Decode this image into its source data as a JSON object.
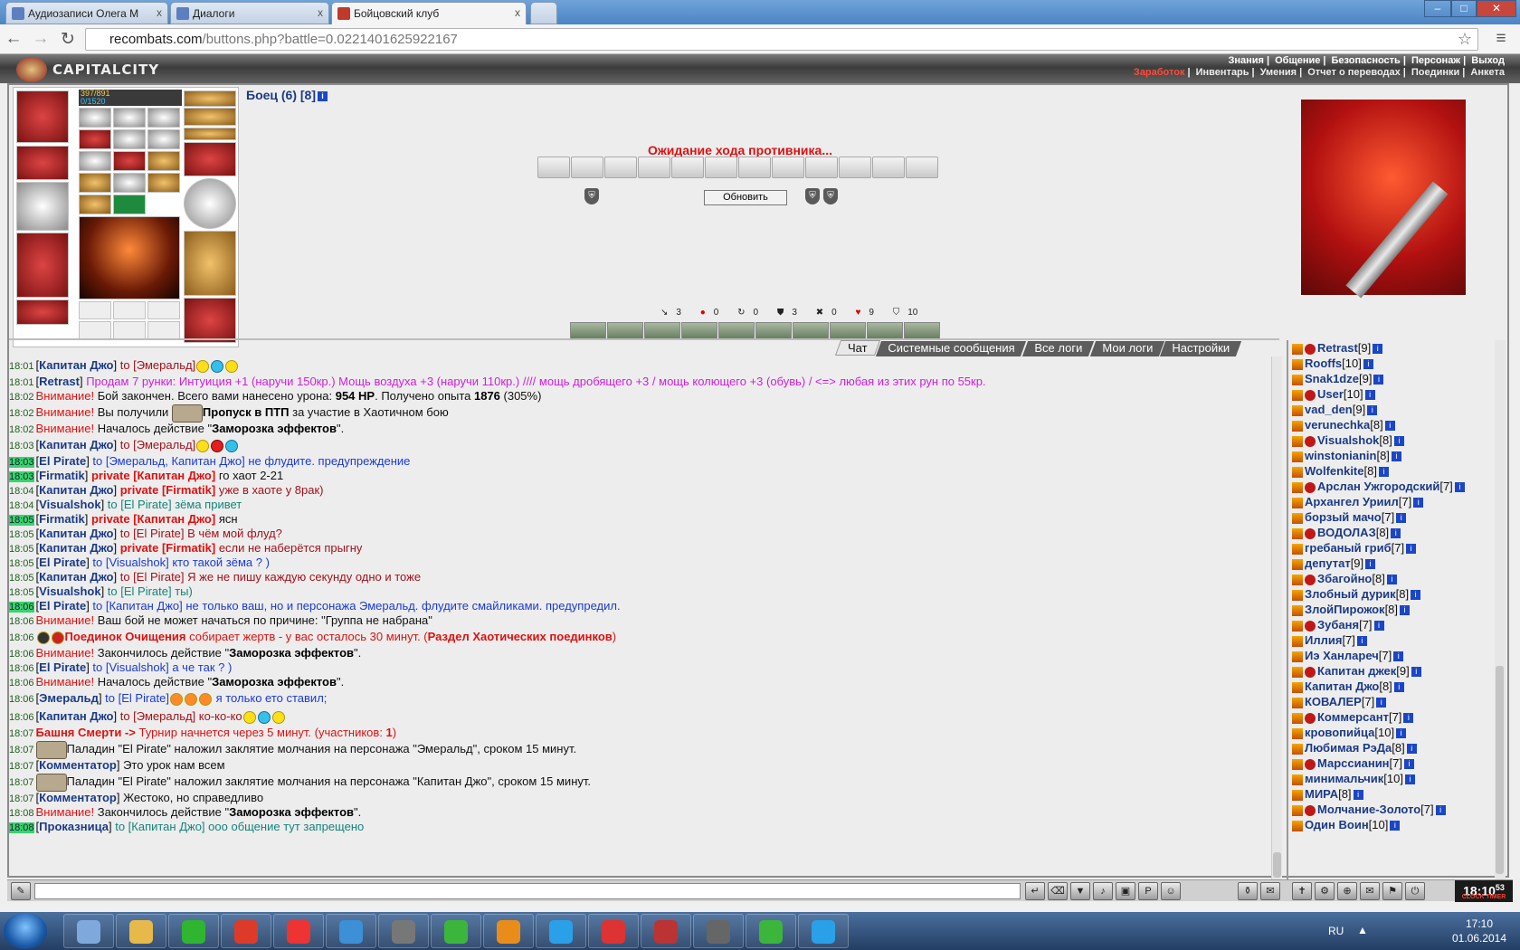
{
  "browser": {
    "tabs": [
      {
        "title": "Аудиозаписи Олега М",
        "icon_color": "#5b7fbf"
      },
      {
        "title": "Диалоги",
        "icon_color": "#5b7fbf"
      },
      {
        "title": "Бойцовский клуб",
        "icon_color": "#c0392b"
      }
    ],
    "close_glyph": "x",
    "window_controls": [
      "–",
      "□",
      "✕"
    ],
    "url_domain": "recombats.com",
    "url_path": "/buttons.php?battle=0.0221401625922167",
    "nav": {
      "back": "←",
      "forward": "→",
      "reload": "↻",
      "star": "☆",
      "menu": "≡"
    }
  },
  "site": {
    "logo": "CAPITALCITY",
    "menu_top": [
      "Знания",
      "Общение",
      "Безопасность",
      "Персонаж",
      "Выход"
    ],
    "menu_bottom": [
      "Заработок",
      "Инвентарь",
      "Умения",
      "Отчет о переводах",
      "Поединки",
      "Анкета"
    ]
  },
  "hero": {
    "hp": "397/891",
    "mp": "0/1520",
    "name": "Боец (6) [8]"
  },
  "battle": {
    "status": "Ожидание хода противника...",
    "refresh": "Обновить",
    "stats": [
      "3",
      "0",
      "0",
      "3",
      "0",
      "9",
      "10"
    ],
    "stat_icons": [
      "↘",
      "●",
      "↻",
      "⛊",
      "✖",
      "♥",
      "⛉"
    ]
  },
  "chat_tabs": [
    "Чат",
    "Системные сообщения",
    "Все логи",
    "Мои логи",
    "Настройки"
  ],
  "chat_lines": [
    {
      "t": "18:01",
      "hl": false,
      "parts": [
        [
          "br",
          "["
        ],
        [
          "nick",
          "Капитан Джо"
        ],
        [
          "br",
          "] "
        ],
        [
          "dred",
          "to [Эмеральд]"
        ]
      ],
      "smiles": [
        "y",
        "b",
        "y"
      ]
    },
    {
      "t": "18:01",
      "hl": false,
      "parts": [
        [
          "br",
          "["
        ],
        [
          "nick",
          "Retrast"
        ],
        [
          "br",
          "] "
        ],
        [
          "mag",
          "Продам 7 рунки: Интуиция +1 (наручи 150кр.) Мощь воздуха +3 (наручи 110кр.) //// мощь дробящего +3 / мощь колющего +3 (обувь) / <=> любая из этих рун по 55кр."
        ]
      ]
    },
    {
      "t": "18:02",
      "hl": false,
      "parts": [
        [
          "red",
          "Внимание! "
        ],
        [
          "br",
          "Бой закончен. Всего вами нанесено урона: "
        ],
        [
          "b",
          "954 HP"
        ],
        [
          "br",
          ". Получено опыта "
        ],
        [
          "b",
          "1876"
        ],
        [
          "br",
          " (305%)"
        ]
      ]
    },
    {
      "t": "18:02",
      "hl": false,
      "ticket": true,
      "parts": [
        [
          "red",
          "Внимание! "
        ],
        [
          "br",
          "Вы получили "
        ],
        [
          "b",
          "Пропуск в ПТП"
        ],
        [
          "br",
          " за участие в Хаотичном бою"
        ]
      ]
    },
    {
      "t": "18:02",
      "hl": false,
      "parts": [
        [
          "red",
          "Внимание! "
        ],
        [
          "br",
          "Началось действие \""
        ],
        [
          "b",
          "Заморозка эффектов"
        ],
        [
          "br",
          "\"."
        ]
      ]
    },
    {
      "t": "18:03",
      "hl": false,
      "parts": [
        [
          "br",
          "["
        ],
        [
          "nick",
          "Капитан Джо"
        ],
        [
          "br",
          "] "
        ],
        [
          "dred",
          "to [Эмеральд]"
        ]
      ],
      "smiles": [
        "y",
        "r",
        "b"
      ]
    },
    {
      "t": "18:03",
      "hl": true,
      "parts": [
        [
          "br",
          "["
        ],
        [
          "nick",
          "El Pirate"
        ],
        [
          "br",
          "] "
        ],
        [
          "blue",
          "to [Эмеральд, Капитан Джо] не флудите. предупреждение"
        ]
      ]
    },
    {
      "t": "18:03",
      "hl": true,
      "parts": [
        [
          "br",
          "["
        ],
        [
          "nick",
          "Firmatik"
        ],
        [
          "br",
          "] "
        ],
        [
          "redb",
          "private [Капитан Джо]"
        ],
        [
          "br",
          " го хаот 2-21"
        ]
      ]
    },
    {
      "t": "18:04",
      "hl": false,
      "parts": [
        [
          "br",
          "["
        ],
        [
          "nick",
          "Капитан Джо"
        ],
        [
          "br",
          "] "
        ],
        [
          "redb",
          "private [Firmatik]"
        ],
        [
          "dred",
          " уже в хаоте у 8рак)"
        ]
      ]
    },
    {
      "t": "18:04",
      "hl": false,
      "parts": [
        [
          "br",
          "["
        ],
        [
          "nick",
          "Visualshok"
        ],
        [
          "br",
          "] "
        ],
        [
          "teal",
          "to [El Pirate] зёма привет"
        ]
      ]
    },
    {
      "t": "18:05",
      "hl": true,
      "parts": [
        [
          "br",
          "["
        ],
        [
          "nick",
          "Firmatik"
        ],
        [
          "br",
          "] "
        ],
        [
          "redb",
          "private [Капитан Джо]"
        ],
        [
          "br",
          " ясн"
        ]
      ]
    },
    {
      "t": "18:05",
      "hl": false,
      "parts": [
        [
          "br",
          "["
        ],
        [
          "nick",
          "Капитан Джо"
        ],
        [
          "br",
          "] "
        ],
        [
          "dred",
          "to [El Pirate] В чём мой флуд?"
        ]
      ]
    },
    {
      "t": "18:05",
      "hl": false,
      "parts": [
        [
          "br",
          "["
        ],
        [
          "nick",
          "Капитан Джо"
        ],
        [
          "br",
          "] "
        ],
        [
          "redb",
          "private [Firmatik]"
        ],
        [
          "dred",
          " если не наберётся прыгну"
        ]
      ]
    },
    {
      "t": "18:05",
      "hl": false,
      "parts": [
        [
          "br",
          "["
        ],
        [
          "nick",
          "El Pirate"
        ],
        [
          "br",
          "] "
        ],
        [
          "blue",
          "to [Visualshok] кто такой зёма ? )"
        ]
      ]
    },
    {
      "t": "18:05",
      "hl": false,
      "parts": [
        [
          "br",
          "["
        ],
        [
          "nick",
          "Капитан Джо"
        ],
        [
          "br",
          "] "
        ],
        [
          "dred",
          "to [El Pirate] Я же не пишу каждую секунду одно и тоже"
        ]
      ]
    },
    {
      "t": "18:05",
      "hl": false,
      "parts": [
        [
          "br",
          "["
        ],
        [
          "nick",
          "Visualshok"
        ],
        [
          "br",
          "] "
        ],
        [
          "teal",
          "to [El Pirate] ты)"
        ]
      ]
    },
    {
      "t": "18:06",
      "hl": true,
      "parts": [
        [
          "br",
          "["
        ],
        [
          "nick",
          "El Pirate"
        ],
        [
          "br",
          "] "
        ],
        [
          "blue",
          "to [Капитан Джо] не только ваш, но и персонажа Эмеральд. флудите смайликами. предупредил."
        ]
      ]
    },
    {
      "t": "18:06",
      "hl": false,
      "parts": [
        [
          "red",
          "Внимание! "
        ],
        [
          "br",
          "Ваш бой не может начаться по причине: \"Группа не набрана\""
        ]
      ]
    },
    {
      "t": "18:06",
      "hl": false,
      "icons": true,
      "parts": [
        [
          "redb",
          "Поединок Очищения"
        ],
        [
          "red",
          " собирает жертв - у вас осталось 30 минут. ("
        ],
        [
          "redb",
          "Раздел Хаотических поединков"
        ],
        [
          "red",
          ")"
        ]
      ]
    },
    {
      "t": "18:06",
      "hl": false,
      "parts": [
        [
          "red",
          "Внимание! "
        ],
        [
          "br",
          "Закончилось действие \""
        ],
        [
          "b",
          "Заморозка эффектов"
        ],
        [
          "br",
          "\"."
        ]
      ]
    },
    {
      "t": "18:06",
      "hl": false,
      "parts": [
        [
          "br",
          "["
        ],
        [
          "nick",
          "El Pirate"
        ],
        [
          "br",
          "] "
        ],
        [
          "blue",
          "to [Visualshok] а че так ? )"
        ]
      ]
    },
    {
      "t": "18:06",
      "hl": false,
      "parts": [
        [
          "red",
          "Внимание! "
        ],
        [
          "br",
          "Началось действие \""
        ],
        [
          "b",
          "Заморозка эффектов"
        ],
        [
          "br",
          "\"."
        ]
      ]
    },
    {
      "t": "18:06",
      "hl": false,
      "smilesMid": true,
      "parts": [
        [
          "br",
          "["
        ],
        [
          "nick",
          "Эмеральд"
        ],
        [
          "br",
          "] "
        ],
        [
          "blue",
          "to [El Pirate]"
        ]
      ],
      "tail": [
        [
          "blue",
          " я только ето ставил;"
        ]
      ]
    },
    {
      "t": "18:06",
      "hl": false,
      "parts": [
        [
          "br",
          "["
        ],
        [
          "nick",
          "Капитан Джо"
        ],
        [
          "br",
          "] "
        ],
        [
          "dred",
          "to [Эмеральд] ко-ко-ко"
        ]
      ],
      "smiles": [
        "y",
        "b",
        "y"
      ]
    },
    {
      "t": "18:07",
      "hl": false,
      "parts": [
        [
          "redb",
          "Башня Смерти -> "
        ],
        [
          "red",
          "Турнир начнется через 5 минут. (участников: "
        ],
        [
          "redb",
          "1"
        ],
        [
          "red",
          ")"
        ]
      ]
    },
    {
      "t": "18:07",
      "hl": false,
      "ticket": true,
      "parts": [
        [
          "br",
          "Паладин \"El Pirate\" наложил заклятие молчания на персонажа \"Эмеральд\", сроком 15 минут."
        ]
      ]
    },
    {
      "t": "18:07",
      "hl": false,
      "parts": [
        [
          "br",
          "["
        ],
        [
          "nick",
          "Комментатор"
        ],
        [
          "br",
          "] Это урок нам всем"
        ]
      ]
    },
    {
      "t": "18:07",
      "hl": false,
      "ticket": true,
      "parts": [
        [
          "br",
          "Паладин \"El Pirate\" наложил заклятие молчания на персонажа \"Капитан Джо\", сроком 15 минут."
        ]
      ]
    },
    {
      "t": "18:07",
      "hl": false,
      "parts": [
        [
          "br",
          "["
        ],
        [
          "nick",
          "Комментатор"
        ],
        [
          "br",
          "] Жестоко, но справедливо"
        ]
      ]
    },
    {
      "t": "18:08",
      "hl": false,
      "parts": [
        [
          "red",
          "Внимание! "
        ],
        [
          "br",
          "Закончилось действие \""
        ],
        [
          "b",
          "Заморозка эффектов"
        ],
        [
          "br",
          "\"."
        ]
      ]
    },
    {
      "t": "18:08",
      "hl": true,
      "parts": [
        [
          "br",
          "["
        ],
        [
          "nick",
          "Проказница"
        ],
        [
          "br",
          "] "
        ],
        [
          "teal",
          "to [Капитан Джо] ооо общение тут запрещено"
        ]
      ]
    }
  ],
  "users": [
    {
      "n": "Retrast",
      "l": "[9]"
    },
    {
      "n": "Rooffs",
      "l": "[10]"
    },
    {
      "n": "Snak1dze",
      "l": "[9]"
    },
    {
      "n": "User",
      "l": "[10]"
    },
    {
      "n": "vad_den",
      "l": "[9]"
    },
    {
      "n": "verunechka",
      "l": "[8]"
    },
    {
      "n": "Visualshok",
      "l": "[8]"
    },
    {
      "n": "winstonianin",
      "l": "[8]"
    },
    {
      "n": "Wolfenkite",
      "l": "[8]"
    },
    {
      "n": "Арслан Ужгородский",
      "l": "[7]"
    },
    {
      "n": "Архангел Уриил",
      "l": "[7]"
    },
    {
      "n": "борзый мачо",
      "l": "[7]"
    },
    {
      "n": "ВОДОЛАЗ",
      "l": "[8]"
    },
    {
      "n": "гребаный гриб",
      "l": "[7]"
    },
    {
      "n": "депутат",
      "l": "[9]"
    },
    {
      "n": "Збагойно",
      "l": "[8]"
    },
    {
      "n": "Злобный дурик",
      "l": "[8]"
    },
    {
      "n": "ЗлойПирожок",
      "l": "[8]"
    },
    {
      "n": "Зубаня",
      "l": "[7]"
    },
    {
      "n": "Иллия",
      "l": "[7]"
    },
    {
      "n": "Иэ Ханлареч",
      "l": "[7]"
    },
    {
      "n": "Капитан джек",
      "l": "[9]"
    },
    {
      "n": "Капитан Джо",
      "l": "[8]"
    },
    {
      "n": "КОВАЛЕР",
      "l": "[7]"
    },
    {
      "n": "Коммерсант",
      "l": "[7]"
    },
    {
      "n": "кровопийца",
      "l": "[10]"
    },
    {
      "n": "Любимая РэДа",
      "l": "[8]"
    },
    {
      "n": "Марссианин",
      "l": "[7]"
    },
    {
      "n": "минимальчик",
      "l": "[10]"
    },
    {
      "n": "МИРА",
      "l": "[8]"
    },
    {
      "n": "Молчание-Золото",
      "l": "[7]"
    },
    {
      "n": "Один Воин",
      "l": "[10]"
    }
  ],
  "clock": {
    "time": "18:10",
    "sec": "53",
    "labels": "CLOCK TIMER"
  },
  "taskbar": {
    "lang": "RU",
    "time": "17:10",
    "date": "01.06.2014",
    "arrow": "▲",
    "apps": [
      "#7fa8dc",
      "#e7b84a",
      "#2fb52f",
      "#de3a2a",
      "#e33",
      "#3d8fd6",
      "#777",
      "#3cb53c",
      "#e98d1a",
      "#2aa0e8",
      "#d33",
      "#b33",
      "#666",
      "#3cb53c",
      "#2aa0e8"
    ]
  }
}
